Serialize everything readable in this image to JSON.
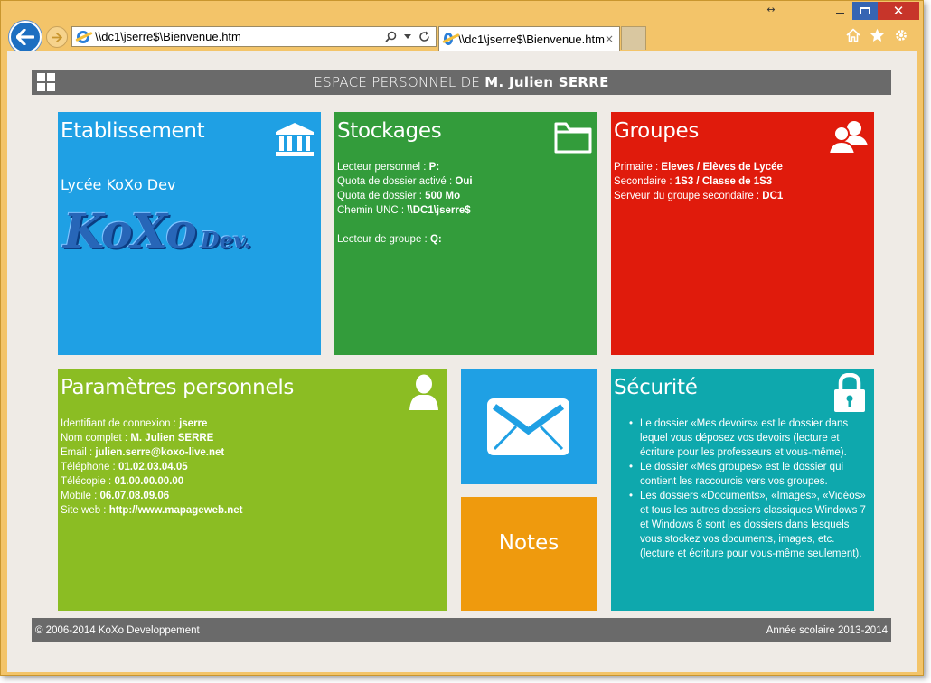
{
  "browser": {
    "address": "\\\\dc1\\jserre$\\Bienvenue.htm",
    "tab_title": "\\\\dc1\\jserre$\\Bienvenue.htm",
    "tab_close": "×",
    "resize_icon": "↔",
    "window_close": "✕",
    "toolbar_icons": [
      "home-icon",
      "star-icon",
      "gear-icon"
    ]
  },
  "header": {
    "title_prefix": "ESPACE PERSONNEL DE ",
    "user": "M. Julien SERRE"
  },
  "etablissement": {
    "title": "Etablissement",
    "icon": "building-icon",
    "name": "Lycée KoXo Dev",
    "logo_main": "KoXo",
    "logo_sub": "Dev."
  },
  "stockages": {
    "title": "Stockages",
    "icon": "folder-icon",
    "rows": [
      {
        "label": "Lecteur personnel : ",
        "value": "P:"
      },
      {
        "label": "Quota de dossier activé : ",
        "value": "Oui"
      },
      {
        "label": "Quota de dossier : ",
        "value": "500 Mo"
      },
      {
        "label": "Chemin UNC : ",
        "value": "\\\\DC1\\jserre$"
      },
      {
        "label": "Lecteur de groupe : ",
        "value": "Q:"
      }
    ]
  },
  "groupes": {
    "title": "Groupes",
    "icon": "users-icon",
    "rows": [
      {
        "label": "Primaire : ",
        "value": "Eleves / Elèves de Lycée"
      },
      {
        "label": "Secondaire : ",
        "value": "1S3 / Classe de 1S3"
      },
      {
        "label": "Serveur du groupe secondaire : ",
        "value": "DC1"
      }
    ]
  },
  "parametres": {
    "title": "Paramètres personnels",
    "icon": "user-icon",
    "rows": [
      {
        "label": "Identifiant de connexion : ",
        "value": "jserre"
      },
      {
        "label": "Nom complet : ",
        "value": "M. Julien SERRE"
      },
      {
        "label": "Email : ",
        "value": "julien.serre@koxo-live.net"
      },
      {
        "label": "Téléphone : ",
        "value": "01.02.03.04.05"
      },
      {
        "label": "Télécopie : ",
        "value": "01.00.00.00.00"
      },
      {
        "label": "Mobile : ",
        "value": "06.07.08.09.06"
      },
      {
        "label": "Site web : ",
        "value": "http://www.mapageweb.net"
      }
    ]
  },
  "mail": {
    "icon": "mail-icon"
  },
  "notes": {
    "label": "Notes"
  },
  "securite": {
    "title": "Sécurité",
    "icon": "lock-icon",
    "items": [
      "Le dossier «Mes devoirs» est le dossier dans lequel vous déposez vos devoirs (lecture et écriture pour les professeurs et vous-même).",
      "Le dossier «Mes groupes» est le dossier qui contient les raccourcis vers vos groupes.",
      "Les dossiers «Documents», «Images», «Vidéos» et tous les autres dossiers classiques Windows 7 et Windows 8 sont les dossiers dans lesquels vous stockez vos documents, images, etc. (lecture et écriture pour vous-même seulement)."
    ]
  },
  "footer": {
    "copyright": "© 2006-2014 KoXo Developpement",
    "year": "Année scolaire 2013-2014"
  },
  "colors": {
    "etablissement": "#1fa0e4",
    "stockages": "#339c3b",
    "groupes": "#e01b0c",
    "parametres": "#8bbd23",
    "mail": "#1fa0e4",
    "notes": "#ef9a0d",
    "securite": "#0ea8ad",
    "bars": "#6a6a6a"
  }
}
